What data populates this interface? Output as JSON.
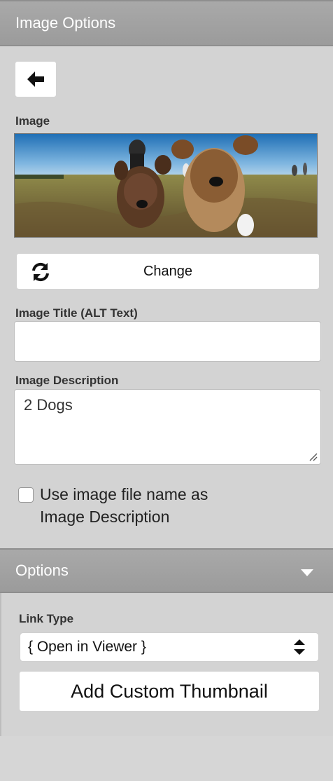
{
  "panel": {
    "header_title": "Image Options",
    "back_icon": "arrow-left-icon"
  },
  "image_section": {
    "label": "Image",
    "preview_alt": "2 Dogs",
    "change_label": "Change",
    "change_icon": "refresh-icon"
  },
  "fields": {
    "title_label": "Image Title (ALT Text)",
    "title_value": "",
    "description_label": "Image Description",
    "description_value": "2 Dogs",
    "use_filename_label": "Use image file name as Image Description",
    "use_filename_checked": false
  },
  "options": {
    "header_title": "Options",
    "header_icon": "caret-down-icon",
    "link_type_label": "Link Type",
    "link_type_value": "{ Open in Viewer }",
    "select_icon": "up-down-arrows-icon",
    "thumbnail_button_label": "Add Custom Thumbnail"
  },
  "colors": {
    "panel_bg": "#d3d3d3",
    "header_bg": "#a3a3a3",
    "header_text": "#ffffff"
  }
}
